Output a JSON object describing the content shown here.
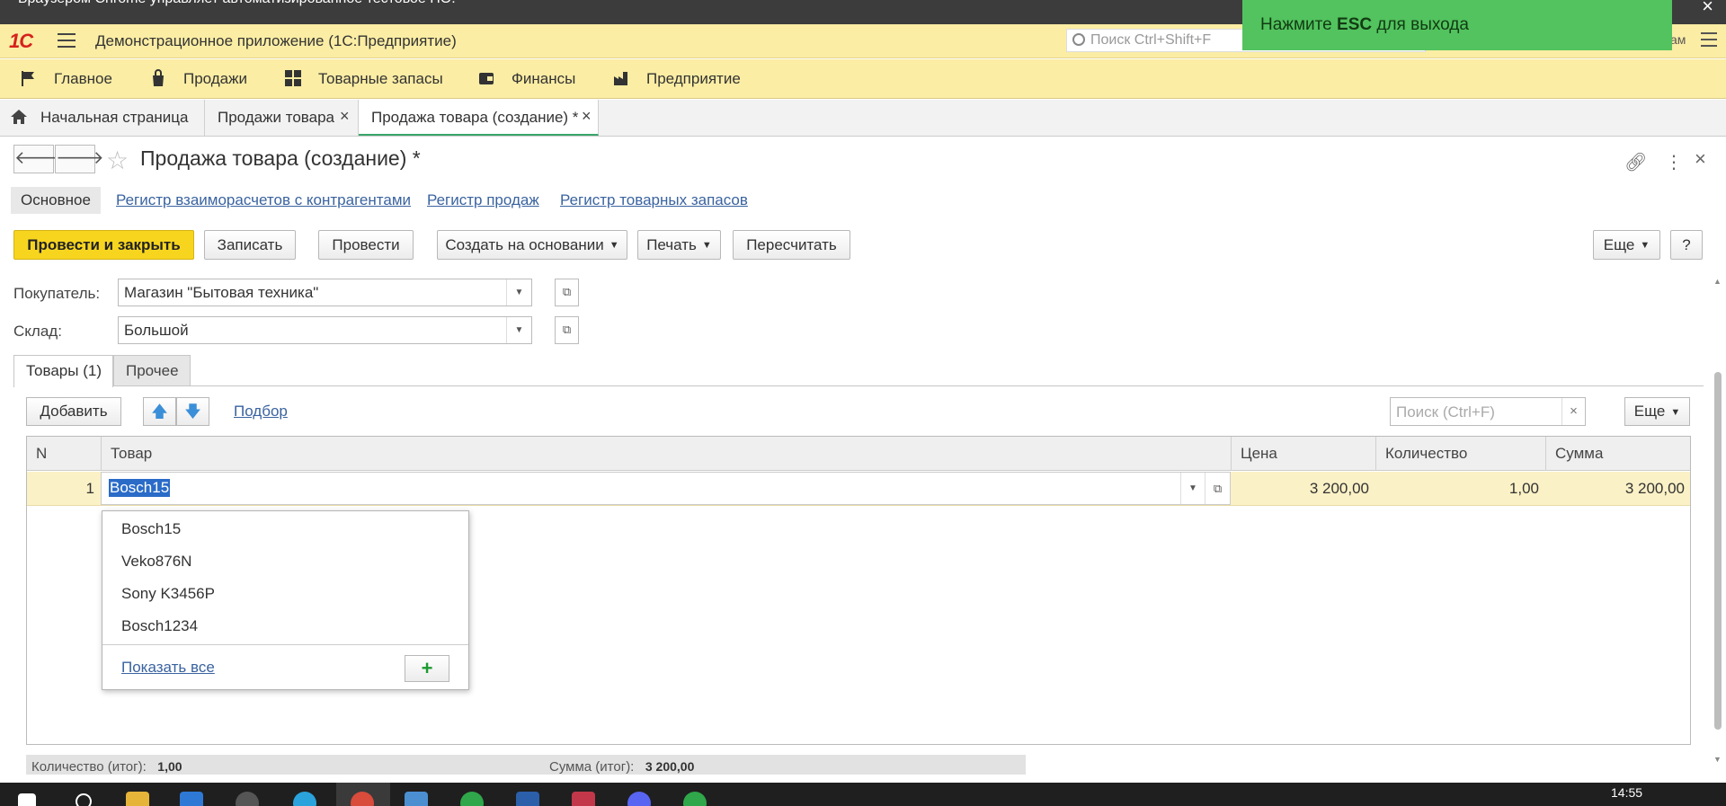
{
  "chrome_banner": {
    "text": "Браузером Chrome управляет автоматизированное тестовое ПО."
  },
  "header": {
    "app_title": "Демонстрационное приложение  (1С:Предприятие)",
    "search_placeholder": "Поиск Ctrl+Shift+F",
    "user_stub": "ам"
  },
  "toast": {
    "prefix": "Нажмите ",
    "key": "ESC",
    "suffix": " для выхода",
    "color": "#52c35e"
  },
  "sections": [
    {
      "label": "Главное",
      "icon": "flag-icon"
    },
    {
      "label": "Продажи",
      "icon": "bag-icon"
    },
    {
      "label": "Товарные запасы",
      "icon": "grid-icon"
    },
    {
      "label": "Финансы",
      "icon": "wallet-icon"
    },
    {
      "label": "Предприятие",
      "icon": "factory-icon"
    }
  ],
  "window_tabs": [
    {
      "label": "Начальная страница"
    },
    {
      "label": "Продажи товара"
    },
    {
      "label": "Продажа товара (создание) *",
      "active": true
    }
  ],
  "form": {
    "title": "Продажа товара (создание) *",
    "nav_main": "Основное",
    "nav_links": [
      "Регистр взаиморасчетов с контрагентами",
      "Регистр продаж",
      "Регистр товарных запасов"
    ]
  },
  "commands": {
    "post_close": "Провести и закрыть",
    "save": "Записать",
    "post": "Провести",
    "create_based": "Создать на основании",
    "print": "Печать",
    "recalc": "Пересчитать",
    "more": "Еще",
    "help": "?"
  },
  "fields": {
    "buyer_label": "Покупатель:",
    "buyer_value": "Магазин \"Бытовая техника\"",
    "warehouse_label": "Склад:",
    "warehouse_value": "Большой"
  },
  "tabs": {
    "goods": "Товары (1)",
    "other": "Прочее"
  },
  "table_bar": {
    "add": "Добавить",
    "pick": "Подбор",
    "search_placeholder": "Поиск (Ctrl+F)",
    "more": "Еще"
  },
  "table": {
    "columns": [
      "N",
      "Товар",
      "Цена",
      "Количество",
      "Сумма"
    ],
    "rows": [
      {
        "n": "1",
        "product": "Bosch15",
        "price": "3 200,00",
        "qty": "1,00",
        "sum": "3 200,00"
      }
    ]
  },
  "dropdown": {
    "items": [
      "Bosch15",
      "Veko876N",
      "Sony K3456P",
      "Bosch1234"
    ],
    "show_all": "Показать все"
  },
  "totals": {
    "qty_label": "Количество (итог):",
    "qty_value": "1,00",
    "sum_label": "Сумма (итог):",
    "sum_value": "3 200,00"
  },
  "taskbar": {
    "time": "14:55"
  }
}
